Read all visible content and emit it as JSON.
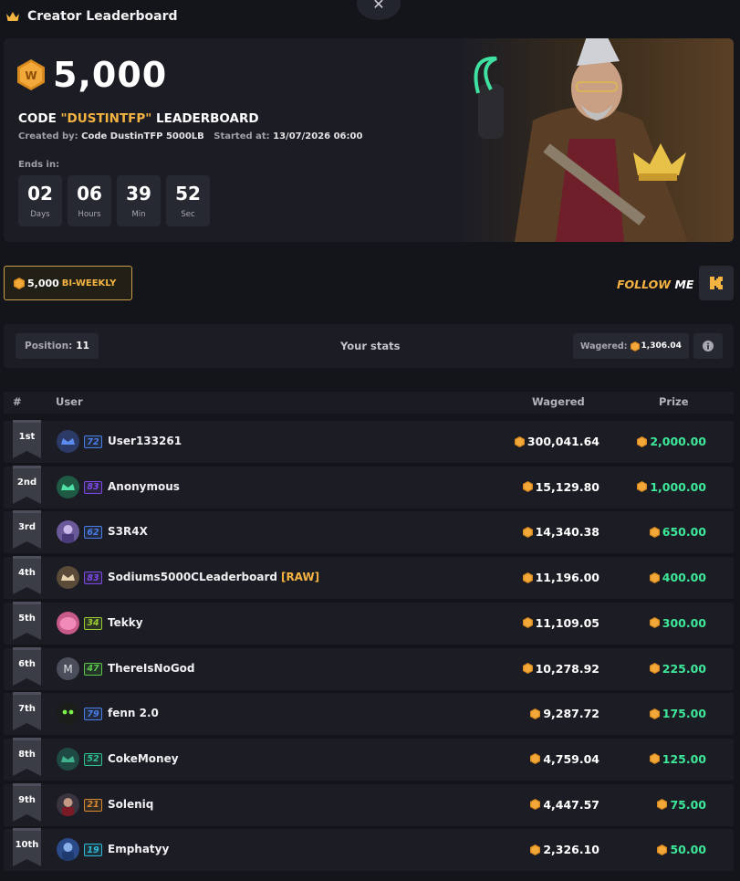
{
  "window": {
    "title": "Creator Leaderboard",
    "close_glyph": "✕"
  },
  "hero": {
    "amount": "5,000",
    "code_prefix": "CODE ",
    "code_highlight": "\"DUSTINTFP\"",
    "code_suffix": " LEADERBOARD",
    "created_by_label": "Created by:",
    "created_by": "Code DustinTFP 5000LB",
    "started_label": "Started at:",
    "started_at": "13/07/2026 06:00",
    "ends_label": "Ends in:",
    "countdown": [
      {
        "value": "02",
        "unit": "Days"
      },
      {
        "value": "06",
        "unit": "Hours"
      },
      {
        "value": "39",
        "unit": "Min"
      },
      {
        "value": "52",
        "unit": "Sec"
      }
    ]
  },
  "badge": {
    "amount": "5,000",
    "period": "BI-WEEKLY"
  },
  "follow": {
    "word1": "FOLLOW",
    "word2": "ME",
    "kick_icon": "kick-icon"
  },
  "stats": {
    "position_label": "Position:",
    "position": "11",
    "center_label": "Your stats",
    "wagered_label": "Wagered:",
    "wagered": "1,306.04"
  },
  "table": {
    "headers": {
      "rank": "#",
      "user": "User",
      "wagered": "Wagered",
      "prize": "Prize"
    },
    "rows": [
      {
        "rank": "1st",
        "level": "72",
        "level_color": "#4a7de8",
        "name": "User133261",
        "tag": "",
        "wagered": "300,041.64",
        "prize": "2,000.00",
        "avatar": "crown-blue"
      },
      {
        "rank": "2nd",
        "level": "83",
        "level_color": "#7d4ae8",
        "name": "Anonymous",
        "tag": "",
        "wagered": "15,129.80",
        "prize": "1,000.00",
        "avatar": "crown-green"
      },
      {
        "rank": "3rd",
        "level": "62",
        "level_color": "#4a7de8",
        "name": "S3R4X",
        "tag": "",
        "wagered": "14,340.38",
        "prize": "650.00",
        "avatar": "character-purple"
      },
      {
        "rank": "4th",
        "level": "83",
        "level_color": "#7d4ae8",
        "name": "Sodiums5000CLeaderboard",
        "tag": "[RAW]",
        "wagered": "11,196.00",
        "prize": "400.00",
        "avatar": "crown-tan"
      },
      {
        "rank": "5th",
        "level": "34",
        "level_color": "#9acd32",
        "name": "Tekky",
        "tag": "",
        "wagered": "11,109.05",
        "prize": "300.00",
        "avatar": "pink-blob"
      },
      {
        "rank": "6th",
        "level": "47",
        "level_color": "#5cc74a",
        "name": "ThereIsNoGod",
        "tag": "",
        "wagered": "10,278.92",
        "prize": "225.00",
        "avatar": "letter-m"
      },
      {
        "rank": "7th",
        "level": "79",
        "level_color": "#4a7de8",
        "name": "fenn 2.0",
        "tag": "",
        "wagered": "9,287.72",
        "prize": "175.00",
        "avatar": "dark-mask"
      },
      {
        "rank": "8th",
        "level": "52",
        "level_color": "#2fbf8f",
        "name": "CokeMoney",
        "tag": "",
        "wagered": "4,759.04",
        "prize": "125.00",
        "avatar": "crown-teal"
      },
      {
        "rank": "9th",
        "level": "21",
        "level_color": "#d88a2e",
        "name": "Soleniq",
        "tag": "",
        "wagered": "4,447.57",
        "prize": "75.00",
        "avatar": "character-dark"
      },
      {
        "rank": "10th",
        "level": "19",
        "level_color": "#2fb8d8",
        "name": "Emphatyy",
        "tag": "",
        "wagered": "2,326.10",
        "prize": "50.00",
        "avatar": "character-blue"
      }
    ]
  },
  "colors": {
    "accent": "#f5b342",
    "prize": "#3ee89a",
    "bg": "#14151b",
    "panel": "#1c1d24"
  }
}
